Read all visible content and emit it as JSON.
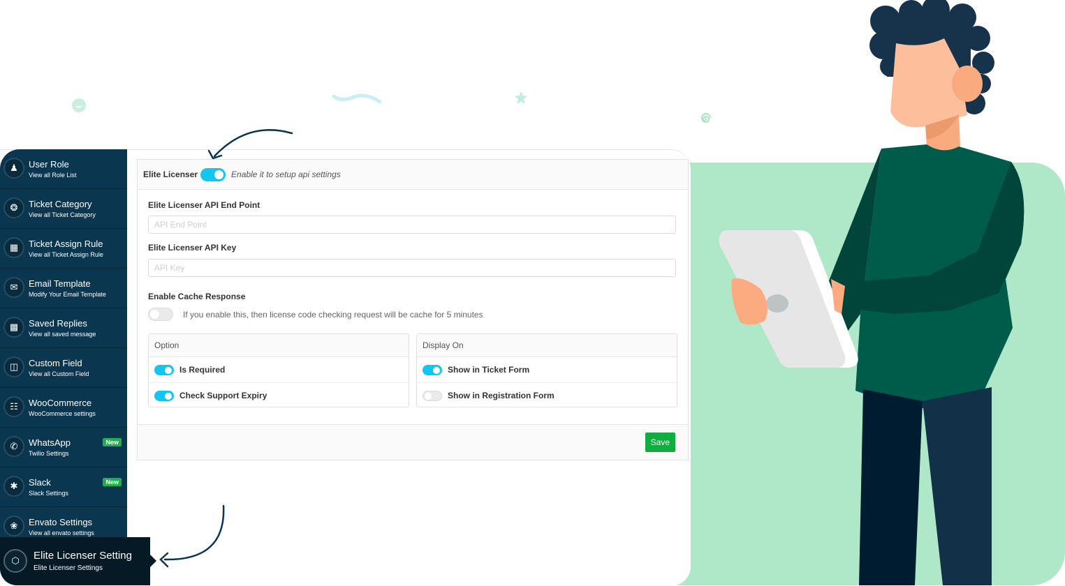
{
  "sidebar": {
    "items": [
      {
        "title": "User Role",
        "subtitle": "View all Role List",
        "icon": "users-icon"
      },
      {
        "title": "Ticket Category",
        "subtitle": "View all Ticket Category",
        "icon": "ticket-icon"
      },
      {
        "title": "Ticket Assign Rule",
        "subtitle": "View all Ticket Assign Rule",
        "icon": "grid-icon"
      },
      {
        "title": "Email Template",
        "subtitle": "Modify Your Email Template",
        "icon": "envelope-open-icon"
      },
      {
        "title": "Saved Replies",
        "subtitle": "View all saved message",
        "icon": "inbox-icon"
      },
      {
        "title": "Custom Field",
        "subtitle": "View all Custom Field",
        "icon": "trello-icon"
      },
      {
        "title": "WooCommerce",
        "subtitle": "WooCommerce settings",
        "icon": "basket-icon"
      },
      {
        "title": "WhatsApp",
        "subtitle": "Twilio Settings",
        "icon": "whatsapp-icon",
        "badge": "New"
      },
      {
        "title": "Slack",
        "subtitle": "Slack Settings",
        "icon": "slack-icon",
        "badge": "New"
      },
      {
        "title": "Envato Settings",
        "subtitle": "View all envato settings",
        "icon": "leaf-icon"
      }
    ],
    "active": {
      "title": "Elite Licenser Setting",
      "subtitle": "Elite Licenser Settings",
      "icon": "elite-licenser-icon"
    }
  },
  "form": {
    "header": {
      "label": "Elite Licenser",
      "enabled": true,
      "hint": "Enable it to setup api settings"
    },
    "endpoint": {
      "label": "Elite Licenser API End Point",
      "value": "",
      "placeholder": "API End Point"
    },
    "apikey": {
      "label": "Elite Licenser API Key",
      "value": "",
      "placeholder": "API Key"
    },
    "cache": {
      "label": "Enable Cache Response",
      "enabled": false,
      "hint": "If you enable this, then license code checking request will be cache for 5 minutes"
    },
    "option_panel": {
      "title": "Option",
      "rows": [
        {
          "label": "Is Required",
          "enabled": true
        },
        {
          "label": "Check Support Expiry",
          "enabled": true
        }
      ]
    },
    "display_panel": {
      "title": "Display On",
      "rows": [
        {
          "label": "Show in Ticket Form",
          "enabled": true
        },
        {
          "label": "Show in Registration Form",
          "enabled": false
        }
      ]
    },
    "save_label": "Save"
  },
  "colors": {
    "sidebar_bg": "#0a3650",
    "active_bg": "#061a26",
    "toggle_on": "#12c6f0",
    "save_green": "#0fae3f",
    "badge_green": "#19b34a",
    "illustration_bg": "#aee8c8"
  }
}
